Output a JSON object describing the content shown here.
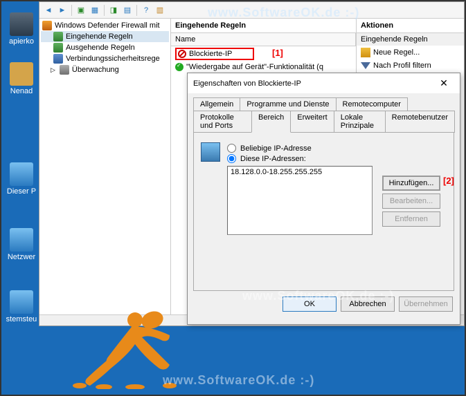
{
  "desktop": {
    "icons": [
      "apierko",
      "Nenad",
      "Dieser P",
      "Netzwer",
      "stemsteu"
    ]
  },
  "watermark": "www.SoftwareOK.de :-)",
  "firewall": {
    "tree": {
      "root": "Windows Defender Firewall mit",
      "items": [
        "Eingehende Regeln",
        "Ausgehende Regeln",
        "Verbindungssicherheitsrege",
        "Überwachung"
      ]
    },
    "center": {
      "title": "Eingehende Regeln",
      "col": "Name",
      "rules": [
        {
          "name": "Blockierte-IP",
          "type": "block"
        },
        {
          "name": "\"Wiedergabe auf Gerät\"-Funktionalität (q",
          "type": "allow"
        }
      ]
    },
    "actions": {
      "title": "Aktionen",
      "group": "Eingehende Regeln",
      "items": [
        "Neue Regel...",
        "Nach Profil filtern"
      ]
    }
  },
  "dialog": {
    "title": "Eigenschaften von Blockierte-IP",
    "tabs_row1": [
      "Allgemein",
      "Programme und Dienste",
      "Remotecomputer"
    ],
    "tabs_row2": [
      "Protokolle und Ports",
      "Bereich",
      "Erweitert",
      "Lokale Prinzipale",
      "Remotebenutzer"
    ],
    "radio_any": "Beliebige IP-Adresse",
    "radio_these": "Diese IP-Adressen:",
    "ip_entry": "18.128.0.0-18.255.255.255",
    "btn_add": "Hinzufügen...",
    "btn_edit": "Bearbeiten...",
    "btn_del": "Entfernen",
    "btn_ok": "OK",
    "btn_cancel": "Abbrechen",
    "btn_apply": "Übernehmen"
  },
  "annotations": {
    "a1": "[1]",
    "a2": "[2]"
  }
}
